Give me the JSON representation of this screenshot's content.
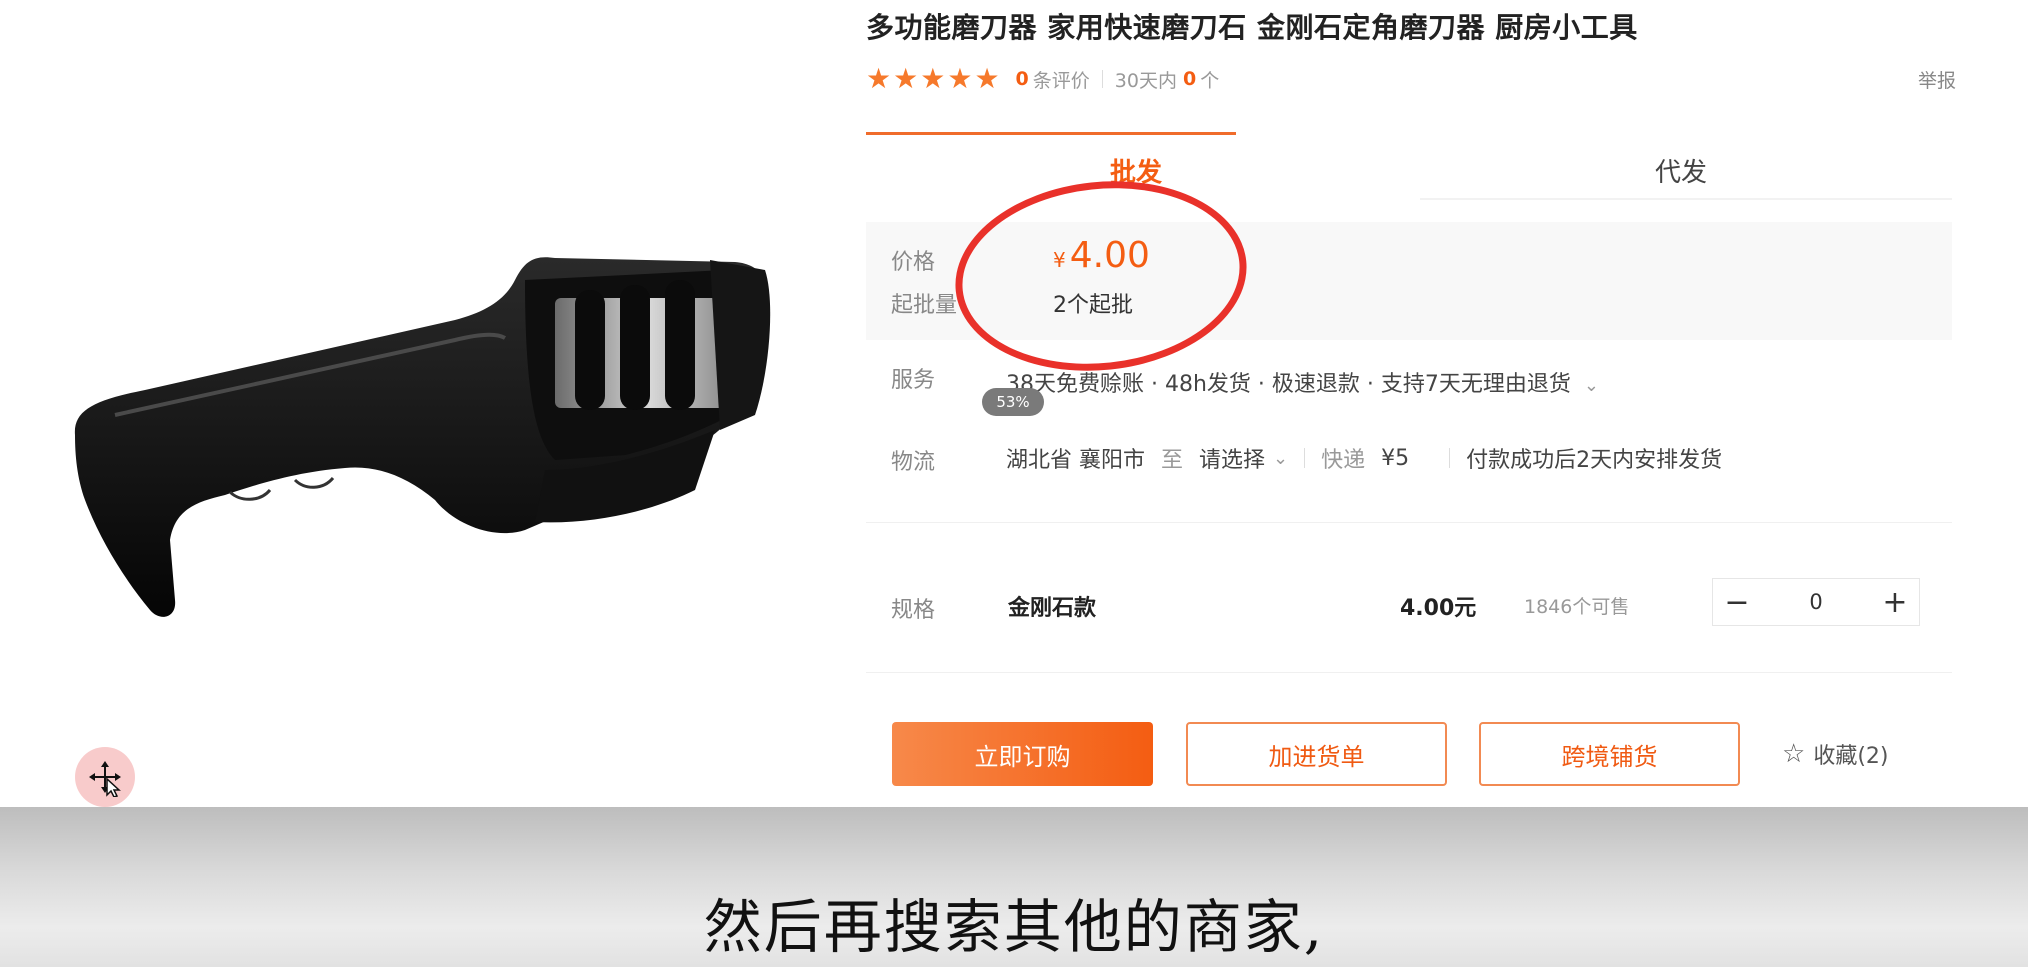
{
  "product": {
    "title": "多功能磨刀器 家用快速磨刀石 金刚石定角磨刀器 厨房小工具",
    "image_icon": "knife-sharpener-image",
    "rating_count": "0",
    "rating_label": "条评价",
    "sales_period_label": "30天内",
    "sales_count": "0",
    "sales_unit": "个",
    "report_label": "举报"
  },
  "tabs": [
    {
      "label": "批发",
      "active": true
    },
    {
      "label": "代发",
      "active": false
    }
  ],
  "price": {
    "label": "价格",
    "symbol": "¥",
    "value": "4.00",
    "moq_label": "起批量",
    "moq_value": "2个起批"
  },
  "service": {
    "label": "服务",
    "text": "38天免费赊账 · 48h发货 · 极速退款 · 支持7天无理由退货"
  },
  "overlay": {
    "progress_badge": "53%"
  },
  "logistics": {
    "label": "物流",
    "from": "湖北省 襄阳市",
    "to_label": "至",
    "destination": "请选择",
    "method": "快递",
    "fee": "¥5",
    "note": "付款成功后2天内安排发货"
  },
  "spec": {
    "label": "规格",
    "name": "金刚石款",
    "price": "4.00元",
    "stock": "1846个可售",
    "quantity": "0"
  },
  "actions": {
    "order": "立即订购",
    "add_cart": "加进货单",
    "cross_border": "跨境铺货",
    "favorite": "收藏(2)"
  },
  "subtitle": "然后再搜索其他的商家,",
  "colors": {
    "accent": "#f45d12",
    "highlight_circle": "#e9312a"
  }
}
